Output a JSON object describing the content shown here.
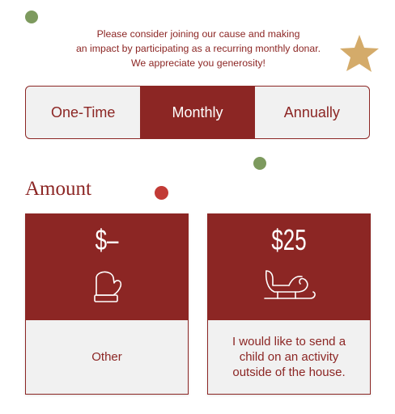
{
  "intro_text": "Please consider joining our cause and making\nan impact by participating as a recurring monthly donar.\nWe appreciate you generosity!",
  "frequency": {
    "tabs": [
      {
        "label": "One-Time",
        "active": false
      },
      {
        "label": "Monthly",
        "active": true
      },
      {
        "label": "Annually",
        "active": false
      }
    ]
  },
  "amount_heading": "Amount",
  "cards": [
    {
      "amount": "$–",
      "icon": "mitten-icon",
      "description": "Other"
    },
    {
      "amount": "$25",
      "icon": "sleigh-icon",
      "description": "I would like to send a child on an activity outside of the house."
    }
  ],
  "colors": {
    "brand_red": "#8c2624",
    "card_background": "#f1f1f1",
    "accent_green": "#7d9a5e",
    "accent_red": "#c23b36",
    "star_gold": "#d4ab6a"
  }
}
